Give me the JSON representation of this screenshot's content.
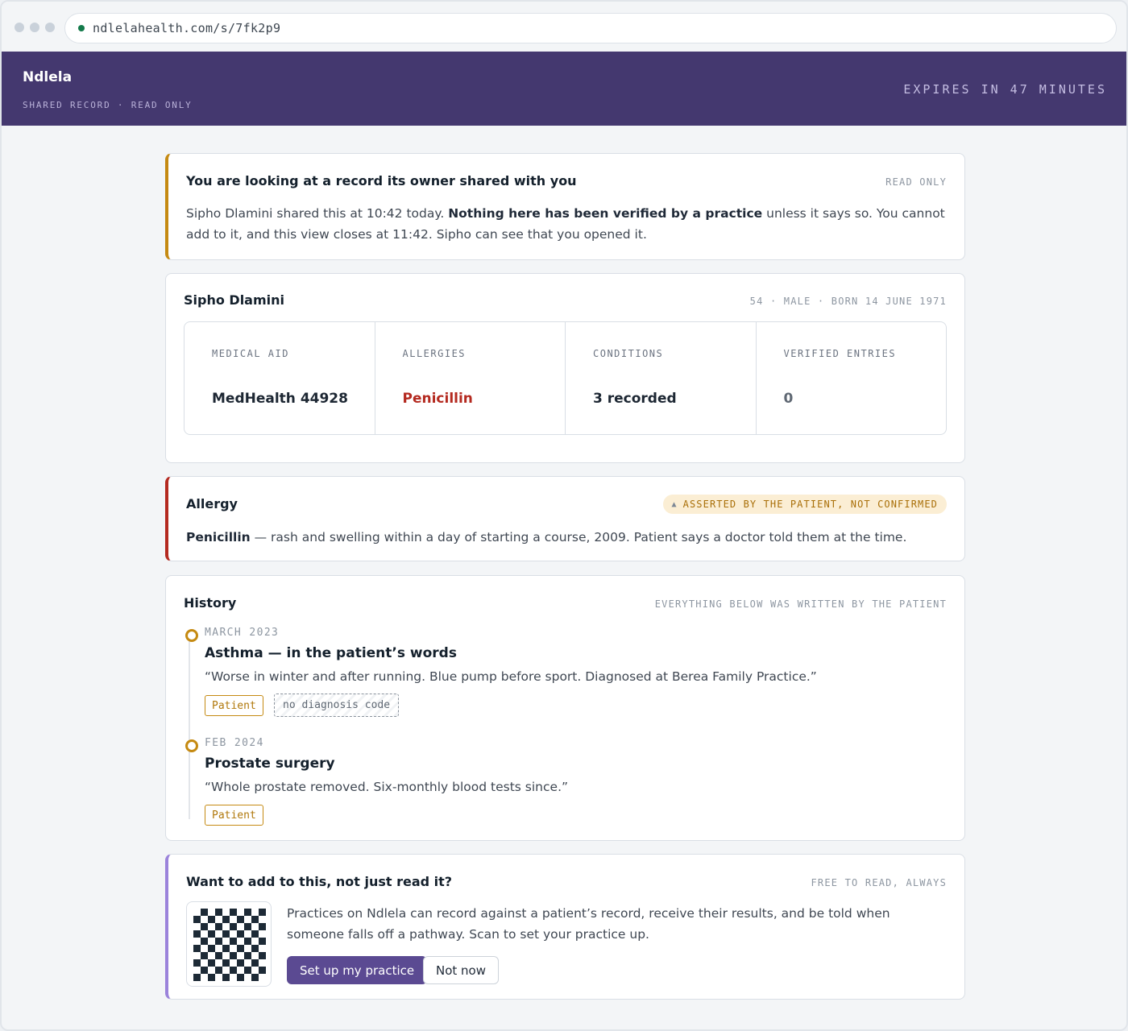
{
  "browser": {
    "url": "ndlelahealth.com/s/7fk2p9"
  },
  "header": {
    "brand": "Ndlela",
    "subtitle": "SHARED RECORD · READ ONLY",
    "expires": "EXPIRES IN 47 MINUTES"
  },
  "notice": {
    "title": "You are looking at a record its owner shared with you",
    "badge": "READ ONLY",
    "text_before": "Sipho Dlamini shared this at 10:42 today. ",
    "text_bold": "Nothing here has been verified by a practice",
    "text_after": " unless it says so. You cannot add to it, and this view closes at 11:42. Sipho can see that you opened it."
  },
  "patient": {
    "name": "Sipho Dlamini",
    "meta": "54 · MALE · BORN 14 JUNE 1971",
    "stats": [
      {
        "label": "MEDICAL AID",
        "value": "MedHealth 44928"
      },
      {
        "label": "ALLERGIES",
        "value": "Penicillin"
      },
      {
        "label": "CONDITIONS",
        "value": "3 recorded"
      },
      {
        "label": "VERIFIED ENTRIES",
        "value": "0"
      }
    ]
  },
  "allergy": {
    "title": "Allergy",
    "badge": "ASSERTED BY THE PATIENT, NOT CONFIRMED",
    "name": "Penicillin",
    "text": " — rash and swelling within a day of starting a course, 2009. Patient says a doctor told them at the time."
  },
  "history": {
    "title": "History",
    "meta": "EVERYTHING BELOW WAS WRITTEN BY THE PATIENT",
    "entries": [
      {
        "date": "MARCH 2023",
        "title": "Asthma — in the patient’s words",
        "quote": "“Worse in winter and after running. Blue pump before sport. Diagnosed at Berea Family Practice.”",
        "tags": [
          "Patient",
          "no diagnosis code"
        ]
      },
      {
        "date": "FEB 2024",
        "title": "Prostate surgery",
        "quote": "“Whole prostate removed. Six-monthly blood tests since.”",
        "tags": [
          "Patient"
        ]
      }
    ]
  },
  "cta": {
    "title": "Want to add to this, not just read it?",
    "meta": "FREE TO READ, ALWAYS",
    "text": "Practices on Ndlela can record against a patient’s record, receive their results, and be told when someone falls off a pathway. Scan to set your practice up.",
    "primary_button": "Set up my practice",
    "secondary_button": "Not now"
  },
  "colors": {
    "header_band": "#44386f",
    "accent_amber": "#c58a12",
    "accent_red": "#b42a20",
    "accent_violet": "#9b83db",
    "primary_button": "#5b4a92"
  }
}
